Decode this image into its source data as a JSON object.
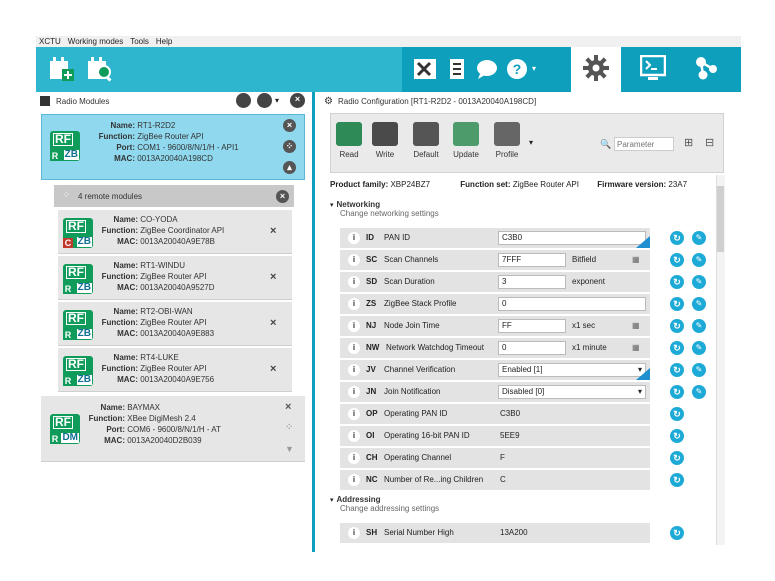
{
  "menu": [
    "XCTU",
    "Working modes",
    "Tools",
    "Help"
  ],
  "left_header": {
    "title": "Radio Modules"
  },
  "right_header": {
    "title": "Radio Configuration [RT1-R2D2 - 0013A20040A198CD]"
  },
  "main_module": {
    "name_k": "Name:",
    "name": "RT1-R2D2",
    "func_k": "Function:",
    "func": "ZigBee Router API",
    "port_k": "Port:",
    "port": "COM1 - 9600/8/N/1/H - API1",
    "mac_k": "MAC:",
    "mac": "0013A20040A198CD",
    "rf": "RF",
    "tag": "ZB",
    "badge": "R"
  },
  "remote": {
    "label": "4 remote modules"
  },
  "remote_modules": [
    {
      "name": "CO-YODA",
      "func": "ZigBee Coordinator API",
      "mac": "0013A20040A9E78B",
      "badge": "C",
      "tag": "ZB",
      "rf": "RF",
      "name_k": "Name:",
      "func_k": "Function:",
      "mac_k": "MAC:"
    },
    {
      "name": "RT1-WINDU",
      "func": "ZigBee Router API",
      "mac": "0013A20040A9527D",
      "badge": "R",
      "tag": "ZB",
      "rf": "RF",
      "name_k": "Name:",
      "func_k": "Function:",
      "mac_k": "MAC:"
    },
    {
      "name": "RT2-OBI-WAN",
      "func": "ZigBee Router API",
      "mac": "0013A20040A9E883",
      "badge": "R",
      "tag": "ZB",
      "rf": "RF",
      "name_k": "Name:",
      "func_k": "Function:",
      "mac_k": "MAC:"
    },
    {
      "name": "RT4-LUKE",
      "func": "ZigBee Router API",
      "mac": "0013A20040A9E756",
      "badge": "R",
      "tag": "ZB",
      "rf": "RF",
      "name_k": "Name:",
      "func_k": "Function:",
      "mac_k": "MAC:"
    }
  ],
  "baymax": {
    "name_k": "Name:",
    "name": "BAYMAX",
    "func_k": "Function:",
    "func": "XBee DigiMesh 2.4",
    "port_k": "Port:",
    "port": "COM6 - 9600/8/N/1/H - AT",
    "mac_k": "MAC:",
    "mac": "0013A20040D2B039",
    "rf": "RF",
    "tag": "DM",
    "badge": "R"
  },
  "ribbon": {
    "read": "Read",
    "write": "Write",
    "default": "Default",
    "update": "Update",
    "profile": "Profile",
    "search_placeholder": "Parameter"
  },
  "product": {
    "family_k": "Product family:",
    "family": "XBP24BZ7",
    "fset_k": "Function set:",
    "fset": "ZigBee Router API",
    "fw_k": "Firmware version:",
    "fw": "23A7"
  },
  "sections": {
    "net_t": "Networking",
    "net_d": "Change networking settings",
    "addr_t": "Addressing",
    "addr_d": "Change addressing settings"
  },
  "params": [
    {
      "code": "ID",
      "name": "PAN ID",
      "value": "C3B0",
      "kind": "input",
      "unit": ""
    },
    {
      "code": "SC",
      "name": "Scan Channels",
      "value": "7FFF",
      "kind": "input",
      "unit": "Bitfield"
    },
    {
      "code": "SD",
      "name": "Scan Duration",
      "value": "3",
      "kind": "input",
      "unit": "exponent"
    },
    {
      "code": "ZS",
      "name": "ZigBee Stack Profile",
      "value": "0",
      "kind": "input",
      "unit": ""
    },
    {
      "code": "NJ",
      "name": "Node Join Time",
      "value": "FF",
      "kind": "input",
      "unit": "x1 sec"
    },
    {
      "code": "NW",
      "name": "Network Watchdog Timeout",
      "value": "0",
      "kind": "input",
      "unit": "x1 minute"
    },
    {
      "code": "JV",
      "name": "Channel Verification",
      "value": "Enabled [1]",
      "kind": "select",
      "unit": ""
    },
    {
      "code": "JN",
      "name": "Join Notification",
      "value": "Disabled [0]",
      "kind": "select",
      "unit": ""
    },
    {
      "code": "OP",
      "name": "Operating PAN ID",
      "value": "C3B0",
      "kind": "ro",
      "unit": ""
    },
    {
      "code": "OI",
      "name": "Operating 16-bit PAN ID",
      "value": "5EE9",
      "kind": "ro",
      "unit": ""
    },
    {
      "code": "CH",
      "name": "Operating Channel",
      "value": "F",
      "kind": "ro",
      "unit": ""
    },
    {
      "code": "NC",
      "name": "Number of Re...ing Children",
      "value": "C",
      "kind": "ro",
      "unit": ""
    }
  ],
  "param_sh": {
    "code": "SH",
    "name": "Serial Number High",
    "value": "13A200"
  },
  "colors": {
    "accent": "#0e9fbd",
    "selected": "#8fd8ee",
    "green": "#0f9c5a",
    "action": "#1eaad6"
  },
  "icons": [
    "add-module-icon",
    "discover-icon",
    "tools-icon",
    "console-icon",
    "chat-icon",
    "help-icon",
    "gear-icon",
    "terminal-icon",
    "network-icon"
  ]
}
